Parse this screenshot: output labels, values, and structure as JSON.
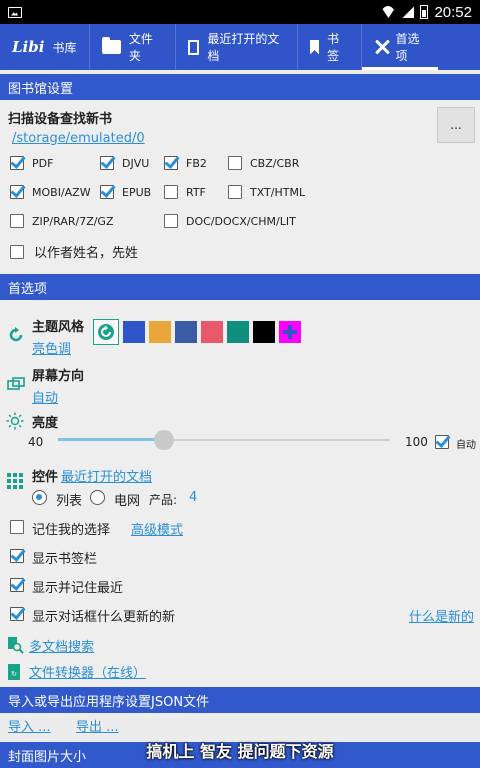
{
  "status_bar": {
    "time": "20:52"
  },
  "tabs": [
    {
      "label": "书库",
      "logo": "Libi"
    },
    {
      "label": "文件夹"
    },
    {
      "label": "最近打开的文档"
    },
    {
      "label": "书签"
    },
    {
      "label": "首选项"
    }
  ],
  "library": {
    "header": "图书馆设置",
    "scan_title": "扫描设备查找新书",
    "scan_path": "/storage/emulated/0",
    "browse_label": "...",
    "formats": [
      {
        "label": "PDF",
        "checked": true
      },
      {
        "label": "DJVU",
        "checked": true
      },
      {
        "label": "FB2",
        "checked": true
      },
      {
        "label": "CBZ/CBR",
        "checked": false
      },
      {
        "label": "MOBI/AZW",
        "checked": true
      },
      {
        "label": "EPUB",
        "checked": true
      },
      {
        "label": "RTF",
        "checked": false
      },
      {
        "label": "TXT/HTML",
        "checked": false
      },
      {
        "label": "ZIP/RAR/7Z/GZ",
        "checked": false
      },
      {
        "label": "DOC/DOCX/CHM/LIT",
        "checked": false
      }
    ],
    "author_name_label": "以作者姓名，先姓"
  },
  "prefs": {
    "header": "首选项",
    "theme_title": "主题风格",
    "theme_value": "亮色调",
    "colors": [
      "#2f55c9",
      "#e9a73a",
      "#3b5ba5",
      "#e85a6a",
      "#0e8f7d",
      "#000000",
      "#ff00ff"
    ],
    "orientation_title": "屏幕方向",
    "orientation_value": "自动",
    "brightness_title": "亮度",
    "brightness_min": "40",
    "brightness_max": "100",
    "brightness_value": 0.32,
    "auto_label": "自动",
    "controls_title": "控件",
    "controls_link": "最近打开的文档",
    "view_list": "列表",
    "view_grid": "电网",
    "items_label": "产品:",
    "items_value": "4",
    "remember_choice": "记住我的选择",
    "advanced_mode": "高级模式",
    "show_bookmarks": "显示书签栏",
    "show_recent": "显示并记住最近",
    "show_whats_new": "显示对话框什么更新的新",
    "whats_new_link": "什么是新的",
    "multi_search": "多文档搜索",
    "converter": "文件转换器（在线）"
  },
  "import_export": {
    "header": "导入或导出应用程序设置JSON文件",
    "import": "导入 ...",
    "export": "导出 ..."
  },
  "cover": {
    "header": "封面图片大小"
  },
  "overlay": "搞机上 智友 提问题下资源"
}
